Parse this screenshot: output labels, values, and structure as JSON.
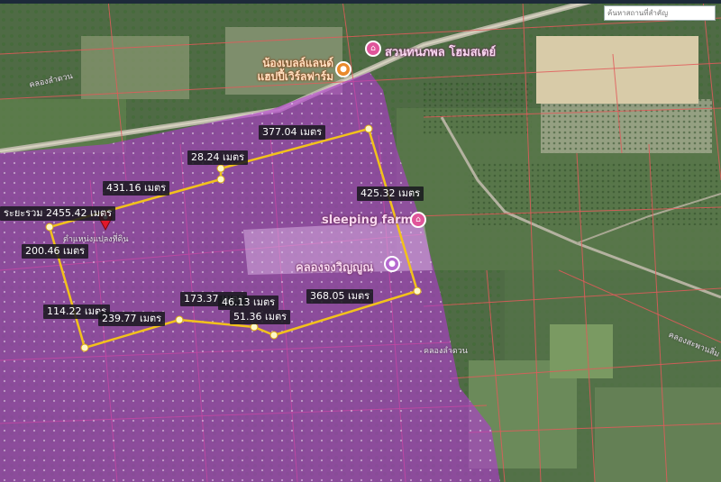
{
  "search": {
    "placeholder": "ค้นหาสถานที่สำคัญ"
  },
  "measurements": {
    "total": "ระยะรวม 2455.42 เมตร",
    "segments": [
      "377.04 เมตร",
      "28.24 เมตร",
      "431.16 เมตร",
      "425.32 เมตร",
      "200.46 เมตร",
      "368.05 เมตร",
      "173.37 เมตร",
      "46.13 เมตร",
      "114.22 เมตร",
      "239.77 เมตร",
      "51.36 เมตร"
    ]
  },
  "places": {
    "resort": "สวนทนภพล โฮมสเตย์",
    "farm": "น้องเบลล์แลนด์ แฮปปี้เวิร์ลฟาร์ม",
    "sleeping_farm": "sleeping farm",
    "canal_temple": "คลองจงวิญญูณ",
    "marker_caption": "ตำแหน่งแปลงที่ดิน"
  },
  "roads": {
    "canal_nw": "คลองลำดวน",
    "canal_se": "คลองสะพานลิ่ม",
    "road_s": "คลองลำดวน"
  },
  "colors": {
    "zone_fill": "#b23ad0",
    "measure_line": "#f2c21b",
    "poi_pink": "#e0559a",
    "poi_orange": "#e98a2c",
    "poi_purple": "#b56ad0"
  },
  "icons": {
    "marker": "location-pin-icon",
    "poi_resort": "lodging-icon",
    "poi_farm": "farm-icon",
    "poi_sleeping": "lodging-icon",
    "poi_temple": "place-pin-icon"
  }
}
